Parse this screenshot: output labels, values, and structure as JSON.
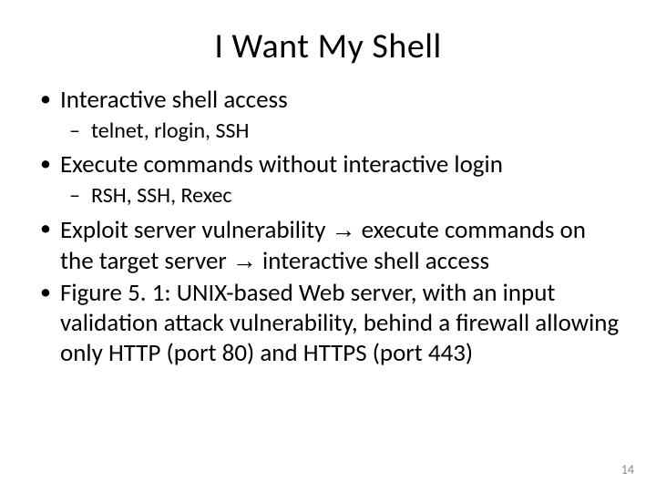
{
  "title": "I Want My Shell",
  "bullets": {
    "b1": "Interactive shell access",
    "b1_sub1": "telnet, rlogin, SSH",
    "b2": "Execute commands without interactive login",
    "b2_sub1": "RSH, SSH, Rexec",
    "b3_part1": "Exploit server vulnerability ",
    "b3_arrow1": "→",
    "b3_part2": " execute commands on the target server ",
    "b3_arrow2": "→",
    "b3_part3": " interactive shell access",
    "b4": "Figure 5. 1: UNIX-based Web server, with an input validation attack vulnerability, behind a firewall allowing only HTTP (port 80) and HTTPS (port 443)"
  },
  "page_number": "14"
}
